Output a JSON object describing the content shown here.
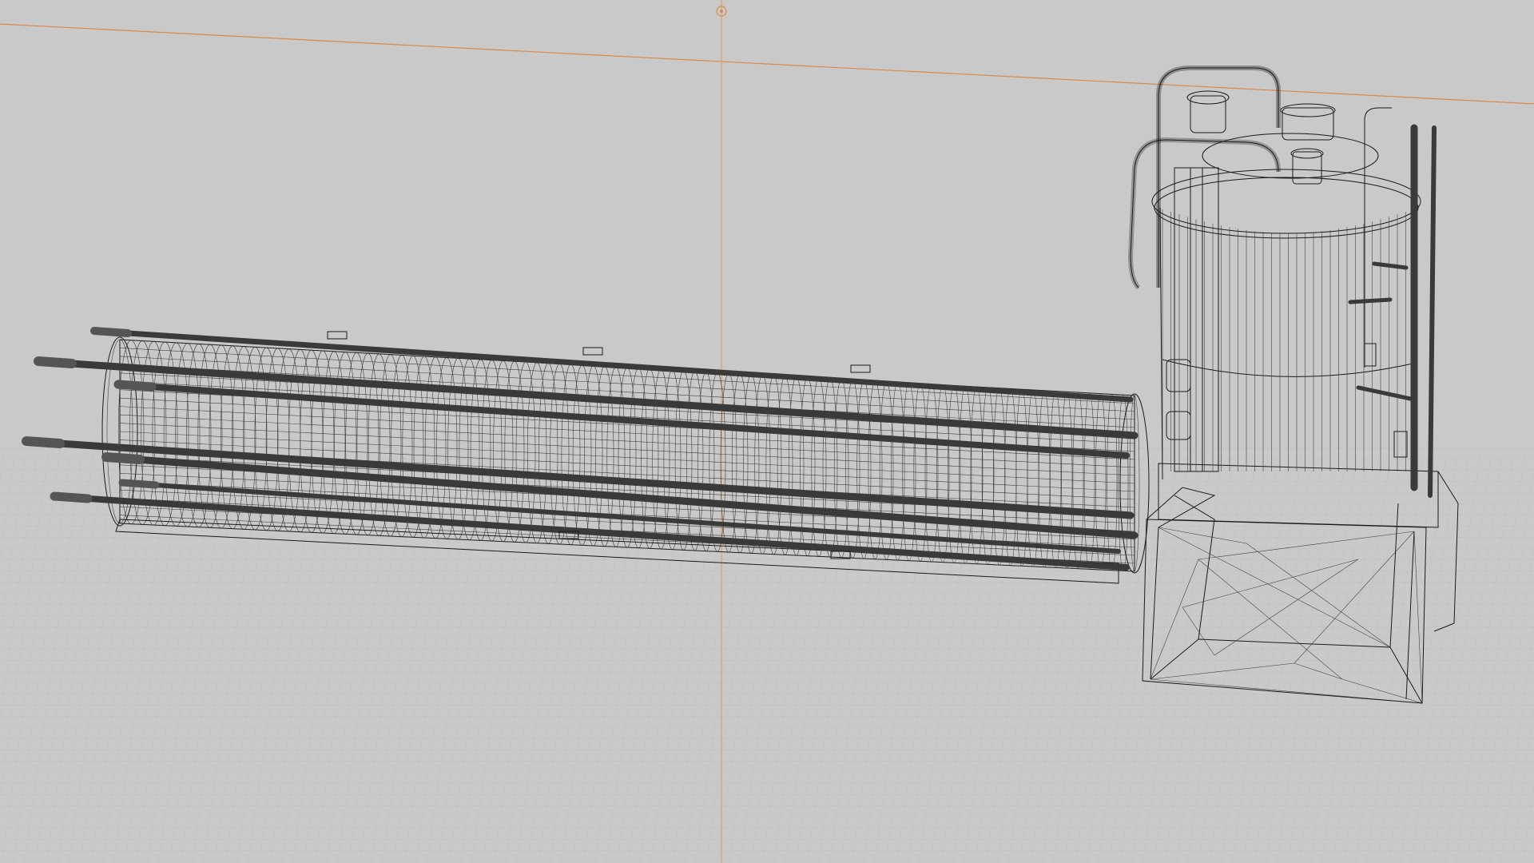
{
  "viewport": {
    "mode": "wireframe",
    "background_color": "#c9c9c9",
    "grid_color": "#b9b9b9",
    "axis_x_color": "#d98a4a",
    "axis_y_color": "#e0a060",
    "wire_color": "#1a1a1a",
    "rod_color": "#3a3a3a"
  },
  "objects": [
    {
      "name": "heat-exchanger-cylinder",
      "kind": "wireframe-mesh"
    },
    {
      "name": "distillation-tank-assembly",
      "kind": "wireframe-mesh"
    }
  ],
  "gizmo": {
    "icon": "world-origin-icon"
  }
}
